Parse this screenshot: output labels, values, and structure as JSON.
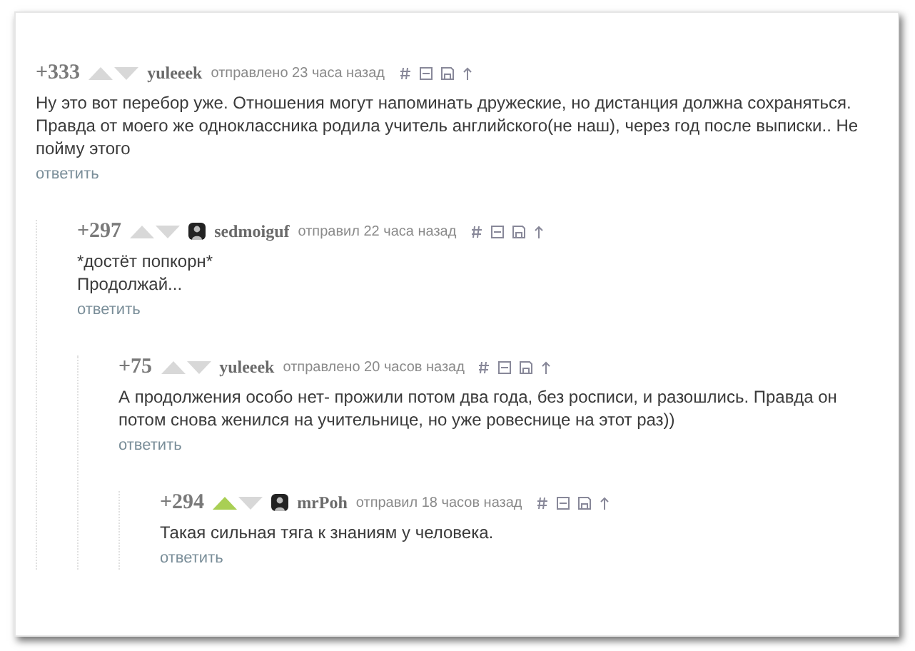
{
  "comments": [
    {
      "score": "+333",
      "upvoted": false,
      "avatar": false,
      "author": "yuleeek",
      "posted": "отправлено 23 часа назад",
      "text": "Ну это вот перебор уже. Отношения могут напоминать дружеские, но дистанция должна сохраняться. Правда от моего же одноклассника родила учитель английского(не наш), через год после выписки.. Не пойму этого",
      "reply": "ответить",
      "children": [
        {
          "score": "+297",
          "upvoted": false,
          "avatar": true,
          "author": "sedmoiguf",
          "posted": "отправил 22 часа назад",
          "text": "*достёт попкорн*\nПродолжай...",
          "reply": "ответить",
          "children": [
            {
              "score": "+75",
              "upvoted": false,
              "avatar": false,
              "author": "yuleeek",
              "posted": "отправлено 20 часов назад",
              "text": "А продолжения особо нет- прожили потом два года, без росписи, и разошлись. Правда он потом снова женился на учительнице, но уже ровеснице на этот раз))",
              "reply": "ответить",
              "children": [
                {
                  "score": "+294",
                  "upvoted": true,
                  "avatar": true,
                  "author": "mrPoh",
                  "posted": "отправил 18 часов назад",
                  "text": "Такая сильная тяга к знаниям у человека.",
                  "reply": "ответить"
                }
              ]
            }
          ]
        }
      ]
    }
  ]
}
